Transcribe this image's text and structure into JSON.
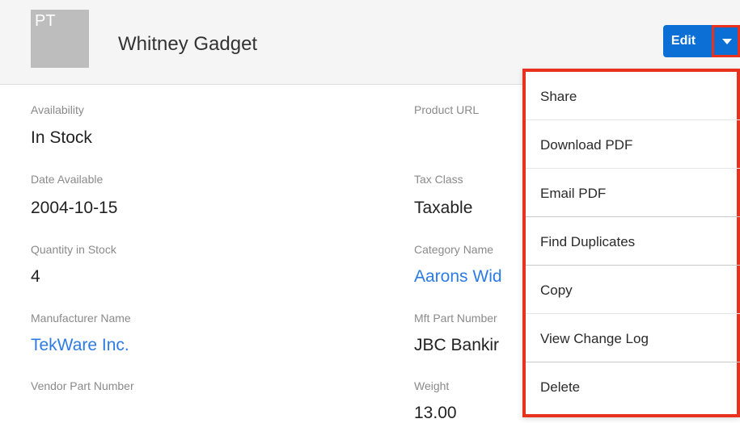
{
  "record": {
    "avatar_initials": "PT",
    "title": "Whitney Gadget",
    "edit_label": "Edit",
    "actions_caret_icon": "caret-down-icon"
  },
  "fields": {
    "availability_label": "Availability",
    "availability_value": "In Stock",
    "date_available_label": "Date Available",
    "date_available_value": "2004-10-15",
    "quantity_label": "Quantity in Stock",
    "quantity_value": "4",
    "manufacturer_label": "Manufacturer Name",
    "manufacturer_value": "TekWare Inc.",
    "vendor_part_label": "Vendor Part Number",
    "product_url_label": "Product URL",
    "tax_class_label": "Tax Class",
    "tax_class_value": "Taxable",
    "category_label": "Category Name",
    "category_value": "Aarons Wid",
    "mft_part_label": "Mft Part Number",
    "mft_part_value": "JBC Bankir",
    "weight_label": "Weight",
    "weight_value": "13.00"
  },
  "menu": {
    "items": [
      "Share",
      "Download PDF",
      "Email PDF",
      "Find Duplicates",
      "Copy",
      "View Change Log",
      "Delete"
    ]
  },
  "colors": {
    "primary": "#0b6fd6",
    "link": "#2c7be5",
    "highlight": "#e8321e"
  }
}
